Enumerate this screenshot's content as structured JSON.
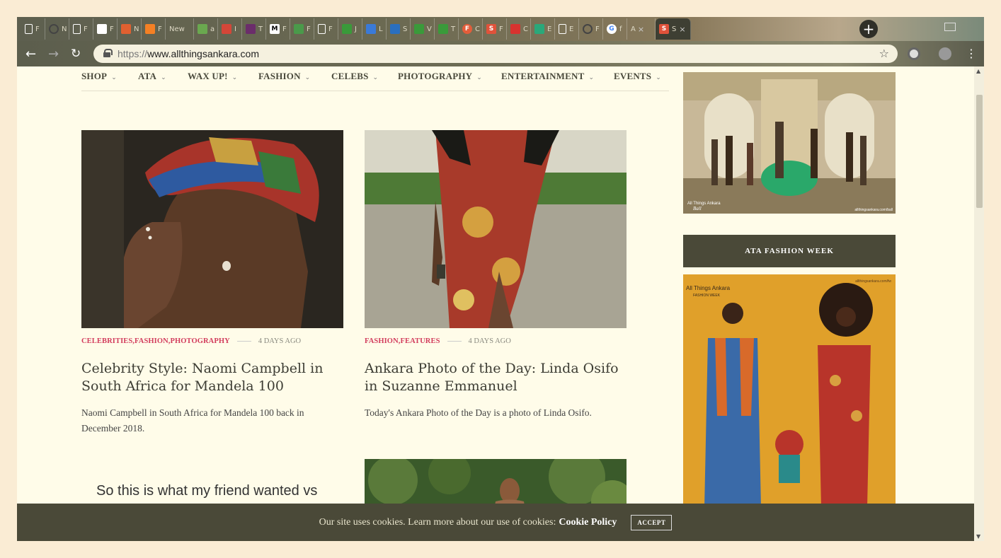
{
  "browser": {
    "tabs": [
      {
        "icon": "page-icon",
        "label": "F",
        "color": "#ffffff"
      },
      {
        "icon": "github-icon",
        "label": "N",
        "color": "#555555"
      },
      {
        "icon": "page-icon",
        "label": "F",
        "color": "#ffffff"
      },
      {
        "icon": "puzzle-icon",
        "label": "F",
        "color": "#ffffff"
      },
      {
        "icon": "book-icon",
        "label": "N",
        "color": "#e06030"
      },
      {
        "icon": "stackoverflow-icon",
        "label": "F",
        "color": "#f48024"
      },
      {
        "icon": "none",
        "label": "New",
        "color": ""
      },
      {
        "icon": "tree-icon",
        "label": "a",
        "color": "#6aa84f"
      },
      {
        "icon": "gmail-icon",
        "label": "I",
        "color": "#d44638"
      },
      {
        "icon": "slack-icon",
        "label": "T",
        "color": "#6b2d6b"
      },
      {
        "icon": "medium-icon",
        "label": "F",
        "color": "#ffffff"
      },
      {
        "icon": "trello-icon",
        "label": "F",
        "color": "#4a9a4a"
      },
      {
        "icon": "page-icon",
        "label": "F",
        "color": "#ffffff"
      },
      {
        "icon": "sheet-icon",
        "label": "J",
        "color": "#3a9a3a"
      },
      {
        "icon": "doc-icon",
        "label": "L",
        "color": "#3a7ad8"
      },
      {
        "icon": "bird-icon",
        "label": "S",
        "color": "#2a6fbf"
      },
      {
        "icon": "sheet-icon",
        "label": "V",
        "color": "#3a9a3a"
      },
      {
        "icon": "sheet-icon",
        "label": "T",
        "color": "#3a9a3a"
      },
      {
        "icon": "f-icon",
        "label": "C",
        "color": "#e35d3a"
      },
      {
        "icon": "s-icon",
        "label": "F",
        "color": "#e0523a"
      },
      {
        "icon": "angular-icon",
        "label": "C",
        "color": "#d8332f"
      },
      {
        "icon": "diamond-icon",
        "label": "E",
        "color": "#2aa87a"
      },
      {
        "icon": "page-icon",
        "label": "E",
        "color": "#ffffff"
      },
      {
        "icon": "github-icon",
        "label": "F",
        "color": "#555555"
      },
      {
        "icon": "google-icon",
        "label": "f",
        "color": "#ffffff"
      },
      {
        "icon": "none",
        "label": "A",
        "color": ""
      },
      {
        "icon": "s-icon",
        "label": "S",
        "color": "#e0523a"
      }
    ],
    "fav_letters": {
      "medium": "M",
      "google": "G",
      "s": "S",
      "f": "F"
    },
    "close_glyph": "×",
    "new_tab_glyph": "+",
    "url_scheme": "https://",
    "url_host": "www.allthingsankara.com"
  },
  "nav": {
    "items": [
      "SHOP",
      "ATA",
      "WAX UP!",
      "FASHION",
      "CELEBS",
      "PHOTOGRAPHY",
      "ENTERTAINMENT",
      "EVENTS"
    ]
  },
  "posts": [
    {
      "categories": "CELEBRITIES,FASHION,PHOTOGRAPHY",
      "ago": "4 DAYS AGO",
      "title": "Celebrity Style: Naomi Campbell in South Africa for Mandela 100",
      "excerpt": "Naomi Campbell in South Africa for Mandela 100 back in December 2018."
    },
    {
      "categories": "FASHION,FEATURES",
      "ago": "4 DAYS AGO",
      "title": "Ankara Photo of the Day: Linda Osifo in Suzanne Emmanuel",
      "excerpt": "Today's Ankara Photo of the Day is a photo of Linda Osifo."
    }
  ],
  "tweet": {
    "text": "So this is what my friend wanted vs what she got 😭💔 Why ?!!"
  },
  "sidebar": {
    "heading": "ATA FASHION WEEK",
    "ball_caption": "All Things Ankara",
    "ball_caption_2": "Ball",
    "ball_credit": "allthingsankara.com/ball",
    "fw_caption": "All Things Ankara",
    "fw_caption_2": "FASHION WEEK",
    "fw_credit": "allthingsankara.com/fw"
  },
  "cookie": {
    "message": "Our site uses cookies. Learn more about our use of cookies:",
    "policy_link": "Cookie Policy",
    "accept_label": "ACCEPT"
  },
  "colors": {
    "accent": "#d23b5c",
    "dark_bar": "#4a4938",
    "page_bg": "#fffce9"
  }
}
